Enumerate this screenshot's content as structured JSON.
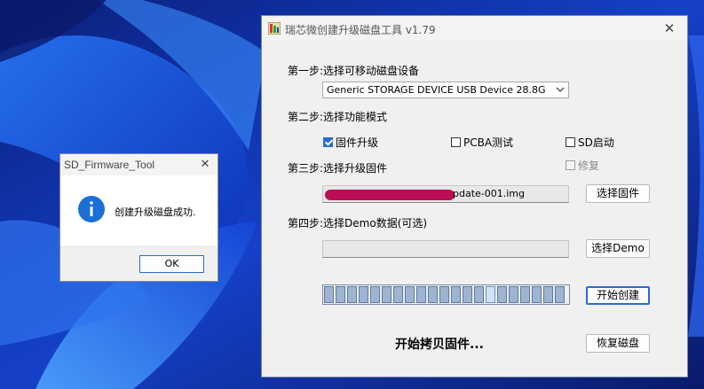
{
  "desktop": {
    "accent": "#1f4fe0"
  },
  "main_window": {
    "title": "瑞芯微创建升级磁盘工具 v1.79",
    "step1_label": "第一步:选择可移动磁盘设备",
    "device_selected": "Generic STORAGE DEVICE USB Device   28.8G",
    "step2_label": "第二步:选择功能模式",
    "modes": [
      {
        "label": "固件升级",
        "checked": true
      },
      {
        "label": "PCBA测试",
        "checked": false
      },
      {
        "label": "SD启动",
        "checked": false
      }
    ],
    "step3_label": "第三步:选择升级固件",
    "repair_label": "修复",
    "repair_checked": false,
    "firmware_path_visible": "pdate-001.img",
    "select_firmware_button": "选择固件",
    "step4_label": "第四步:选择Demo数据(可选)",
    "demo_path": "",
    "select_demo_button": "选择Demo",
    "start_button": "开始创建",
    "progress": {
      "segments_total": 21,
      "highlight_segment": 14
    },
    "status_text": "开始拷贝固件...",
    "restore_button": "恢复磁盘"
  },
  "dialog": {
    "title": "SD_Firmware_Tool",
    "message": "创建升级磁盘成功.",
    "ok_button": "OK",
    "icon": "info-icon"
  }
}
